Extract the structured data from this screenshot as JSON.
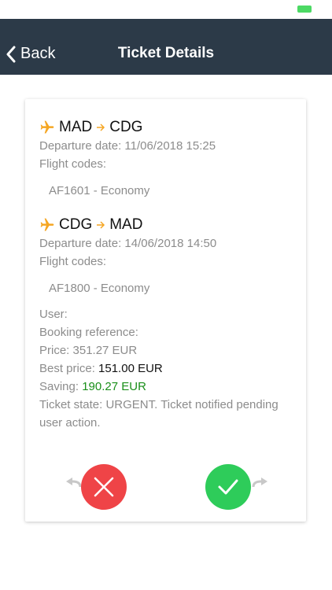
{
  "nav": {
    "back_label": "Back",
    "title": "Ticket Details"
  },
  "flights": [
    {
      "origin": "MAD",
      "destination": "CDG",
      "departure": "Departure date: 11/06/2018 15:25",
      "codes_label": "Flight codes:",
      "code": "AF1601 - Economy"
    },
    {
      "origin": "CDG",
      "destination": "MAD",
      "departure": "Departure date: 14/06/2018 14:50",
      "codes_label": "Flight codes:",
      "code": "AF1800 - Economy"
    }
  ],
  "details": {
    "user_label": "User:",
    "booking_label": "Booking reference:",
    "price_text": "Price: 351.27 EUR",
    "best_price_label": "Best price: ",
    "best_price_value": "151.00 EUR",
    "saving_label": "Saving: ",
    "saving_value": "190.27 EUR",
    "state_text": "Ticket state: URGENT. Ticket notified pending user action."
  },
  "colors": {
    "navbar": "#2c3a48",
    "accent_plane": "#f5a623",
    "reject": "#ef4447",
    "accept": "#2ecc5a",
    "saving": "#1a8f1a"
  },
  "icons": {
    "back": "chevron-left-icon",
    "plane": "airplane-icon",
    "route_arrow": "arrow-right-icon",
    "reject": "close-icon",
    "accept": "check-icon"
  }
}
